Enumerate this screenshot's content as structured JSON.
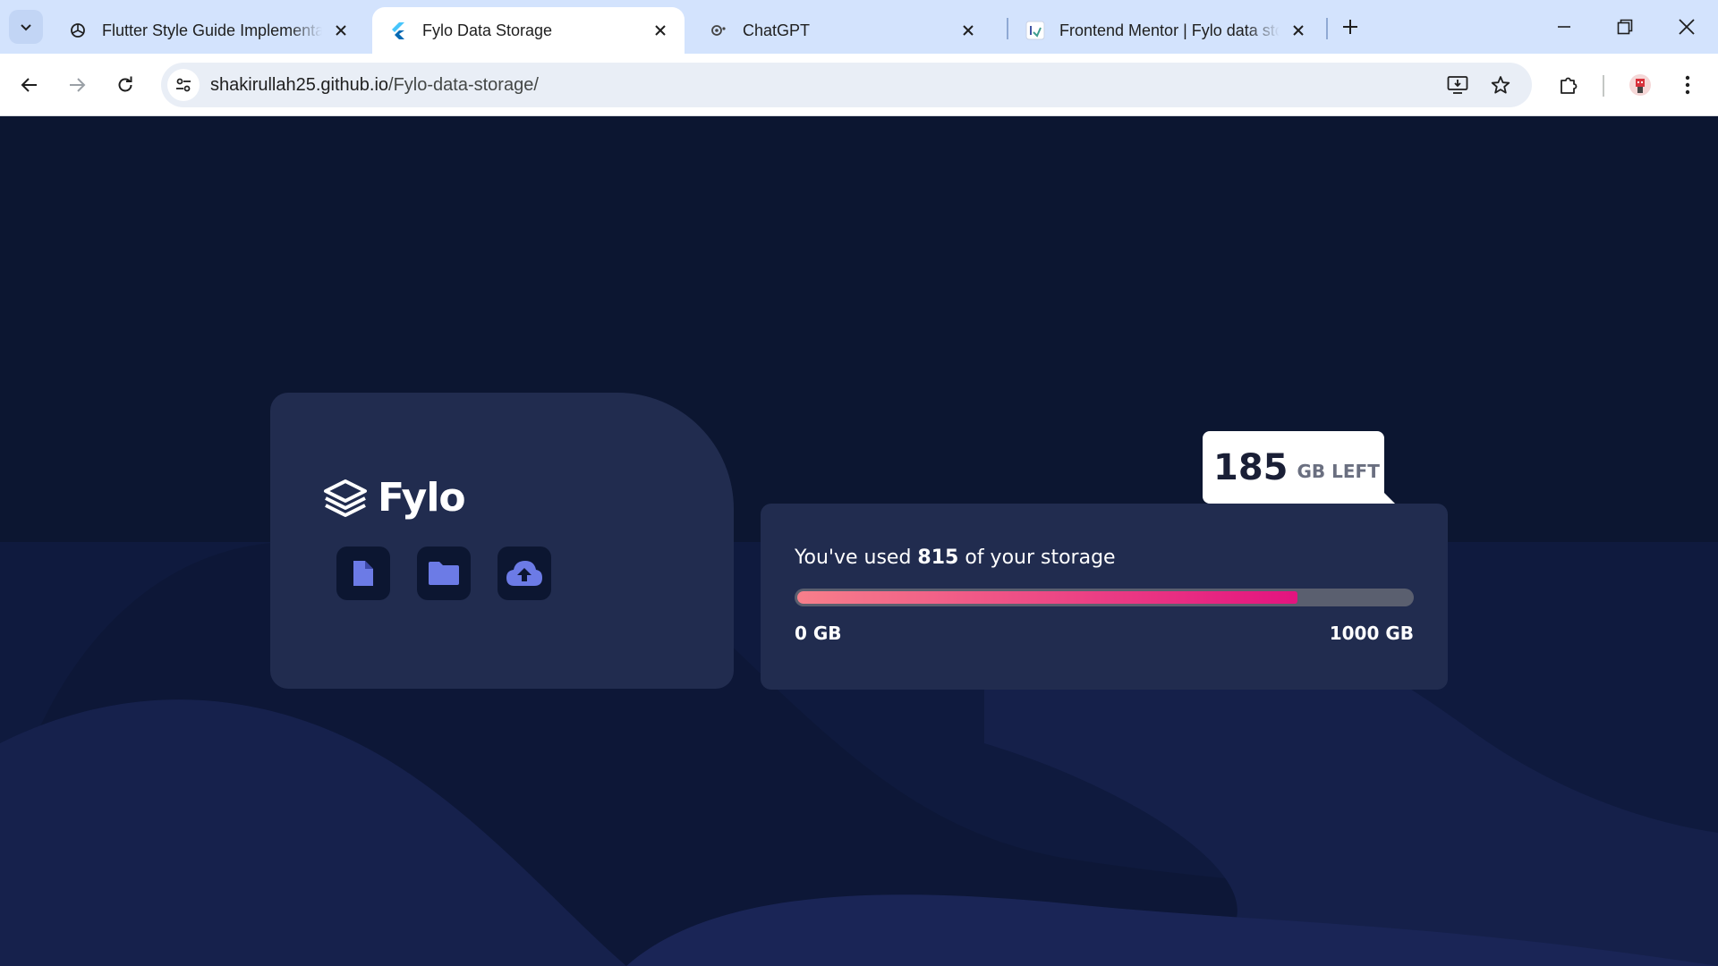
{
  "browser": {
    "tabs": [
      {
        "title": "Flutter Style Guide Implementat",
        "favicon": "openai-icon",
        "active": false
      },
      {
        "title": "Fylo Data Storage",
        "favicon": "flutter-icon",
        "active": true
      },
      {
        "title": "ChatGPT",
        "favicon": "chatgpt-icon",
        "active": false
      },
      {
        "title": "Frontend Mentor | Fylo data sto",
        "favicon": "frontend-mentor-icon",
        "active": false
      }
    ],
    "address": {
      "host": "shakirullah25.github.io",
      "path": "/Fylo-data-storage/"
    }
  },
  "page": {
    "brand": {
      "name": "Fylo"
    },
    "actions": [
      {
        "name": "document-icon"
      },
      {
        "name": "folder-icon"
      },
      {
        "name": "upload-icon"
      }
    ],
    "storage": {
      "text_prefix": "You've used ",
      "used": "815",
      "text_suffix": " of your storage",
      "min_label": "0 GB",
      "max_label": "1000 GB",
      "used_fraction": 0.815,
      "left_value": "185",
      "left_unit": "GB LEFT"
    },
    "colors": {
      "background": "#0c1631",
      "card": "#212c4f",
      "gradient_start": "#f77f8b",
      "gradient_end": "#e3137f",
      "icon": "#6c7be6"
    }
  }
}
